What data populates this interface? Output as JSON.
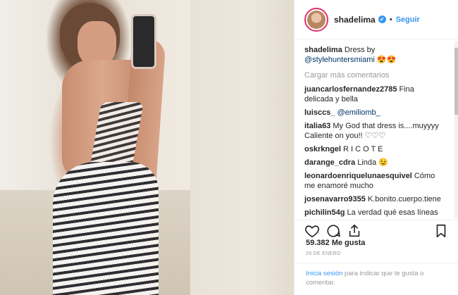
{
  "post": {
    "username": "shadelima",
    "follow_label": "Seguir",
    "separator": "•",
    "verified_mark": "✔"
  },
  "caption": {
    "username": "shadelima",
    "text": "Dress by ",
    "mention": "@stylehuntersmiami",
    "emoji": " 😍😍"
  },
  "load_more": "Cargar más comentarios",
  "comments": [
    {
      "user": "juancarlosfernandez2785",
      "text": "Fina delicada y bella"
    },
    {
      "user": "luisccs_",
      "text": "@emiliomb_"
    },
    {
      "user": "italia63",
      "text": "My God that dress is....muyyyy Caliente on you!! ♡♡♡"
    },
    {
      "user": "oskrkngel",
      "text": "R I C O T E"
    },
    {
      "user": "darange_cdra",
      "text": "Linda 😉"
    },
    {
      "user": "leonardoenriquelunaesquivel",
      "text": "Cómo me enamoré mucho"
    },
    {
      "user": "josenavarro9355",
      "text": "K.bonito.cuerpo.tiene"
    },
    {
      "user": "pichilin54g",
      "text": "La verdad qué esas líneas de zebras qué enseñas a vuelta redonda de tu cuerpo y vienen terminando en tu nalgas se"
    }
  ],
  "likes": "59.382 Me gusta",
  "date": "26 DE ENERO",
  "login": {
    "link": "Inicia sesión",
    "text": " para indicar que te gusta o comentar."
  },
  "icons": [
    "heart-icon",
    "comment-icon",
    "share-icon",
    "bookmark-icon"
  ]
}
